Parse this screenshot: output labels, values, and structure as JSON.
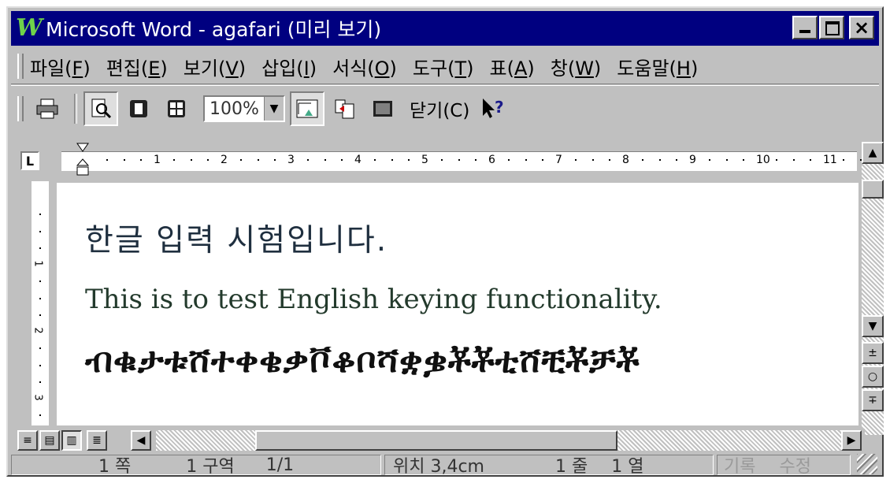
{
  "window": {
    "title": "Microsoft Word - agafari (미리 보기)",
    "app_icon": "W"
  },
  "menu": [
    {
      "label": "파일(",
      "key": "F",
      "end": ")"
    },
    {
      "label": "편집(",
      "key": "E",
      "end": ")"
    },
    {
      "label": "보기(",
      "key": "V",
      "end": ")"
    },
    {
      "label": "삽입(",
      "key": "I",
      "end": ")"
    },
    {
      "label": "서식(",
      "key": "O",
      "end": ")"
    },
    {
      "label": "도구(",
      "key": "T",
      "end": ")"
    },
    {
      "label": "표(",
      "key": "A",
      "end": ")"
    },
    {
      "label": "창(",
      "key": "W",
      "end": ")"
    },
    {
      "label": "도움말(",
      "key": "H",
      "end": ")"
    }
  ],
  "toolbar": {
    "zoom_value": "100%",
    "close_label": "닫기(C)",
    "help_label": "?"
  },
  "ruler": {
    "numbers": [
      "1",
      "2",
      "3",
      "4",
      "5",
      "6",
      "7",
      "8",
      "9",
      "10",
      "11"
    ],
    "vertical_numbers": [
      "1",
      "2",
      "3"
    ]
  },
  "document": {
    "line1": "한글 입력 시험입니다.",
    "line2": "This is to test English keying functionality.",
    "line3": "ብቁታቱሸተቀቄቃቮቆቦሻቋቌቾቾቲሸቺቾቻቾ"
  },
  "status": {
    "page": "1 쪽",
    "section": "1 구역",
    "page_count": "1/1",
    "position": "위치 3,4cm",
    "line": "1 줄",
    "column": "1 열",
    "rec": "기록",
    "trk": "수정"
  }
}
